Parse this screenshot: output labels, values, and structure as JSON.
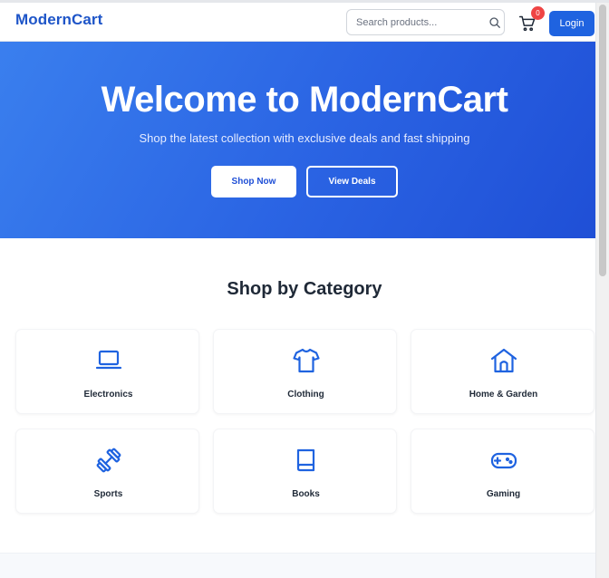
{
  "header": {
    "logo": "ModernCart",
    "search": {
      "placeholder": "Search products..."
    },
    "cart": {
      "count": "0"
    },
    "login_label": "Login"
  },
  "hero": {
    "title": "Welcome to ModernCart",
    "subtitle": "Shop the latest collection with exclusive deals and fast shipping",
    "shop_now_label": "Shop Now",
    "view_deals_label": "View Deals"
  },
  "categories": {
    "title": "Shop by Category",
    "items": [
      {
        "label": "Electronics",
        "icon": "laptop-icon"
      },
      {
        "label": "Clothing",
        "icon": "shirt-icon"
      },
      {
        "label": "Home & Garden",
        "icon": "house-icon"
      },
      {
        "label": "Sports",
        "icon": "dumbbell-icon"
      },
      {
        "label": "Books",
        "icon": "book-icon"
      },
      {
        "label": "Gaming",
        "icon": "gamepad-icon"
      }
    ]
  },
  "colors": {
    "brand": "#1e55c8",
    "hero_gradient": [
      "#3a7fee",
      "#1f4fd6"
    ],
    "badge": "#ef4444",
    "icon": "#1f63e0"
  }
}
